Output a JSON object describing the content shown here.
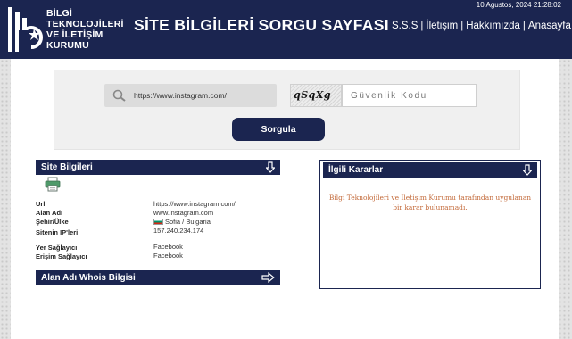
{
  "header": {
    "logo_lines": [
      "BİLGİ",
      "TEKNOLOJİLERİ",
      "VE İLETİŞİM",
      "KURUMU"
    ],
    "title": "SİTE BİLGİLERİ SORGU SAYFASI",
    "datetime": "10 Agustos, 2024 21:28:02",
    "nav": [
      "S.S.S",
      "İletişim",
      "Hakkımızda",
      "Anasayfa"
    ],
    "nav_separator": "|"
  },
  "search": {
    "url_value": "https://www.instagram.com/",
    "captcha_text": "qSqXg",
    "captcha_placeholder": "Güvenlik Kodu",
    "submit_label": "Sorgula"
  },
  "site_info": {
    "header": "Site Bilgileri",
    "rows": [
      {
        "label": "Url",
        "value": "https://www.instagram.com/"
      },
      {
        "label": "Alan Adı",
        "value": "www.instagram.com"
      },
      {
        "label": "Şehir/Ülke",
        "value": "Sofia / Bulgaria"
      },
      {
        "label": "Sitenin IP'leri",
        "value": "157.240.234.174"
      },
      {
        "label": "Yer Sağlayıcı",
        "value": "Facebook"
      },
      {
        "label": "Erişim Sağlayıcı",
        "value": "Facebook"
      }
    ]
  },
  "whois": {
    "header": "Alan Adı Whois Bilgisi"
  },
  "decisions": {
    "header": "İlgili Kararlar",
    "message": "Bilgi Teknolojileri ve İletişim Kurumu tarafından uygulanan bir karar bulunamadı."
  },
  "colors": {
    "navy": "#1b2550",
    "message_orange": "#c36a3a"
  },
  "icons": [
    "logo-emblem",
    "search-icon",
    "printer-icon",
    "down-arrow-icon",
    "right-arrow-icon",
    "bulgaria-flag-icon"
  ]
}
